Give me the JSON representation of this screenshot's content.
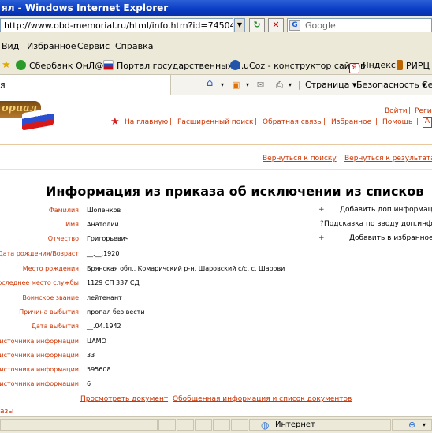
{
  "window": {
    "title": "ял - Windows Internet Explorer"
  },
  "address": {
    "url": "http://www.obd-memorial.ru/html/info.htm?id=74504404",
    "refresh_icon": "refresh-arrows",
    "stop_icon": "stop-x"
  },
  "search": {
    "placeholder": "Google",
    "icon": "google-icon"
  },
  "menu": {
    "items": [
      "Вид",
      "Избранное",
      "Сервис",
      "Справка"
    ]
  },
  "favorites": {
    "items": [
      {
        "label": "Сбербанк ОнЛ@йн",
        "icon": "sberbank-icon",
        "color": "#2a9a2a"
      },
      {
        "label": "Портал государственных ...",
        "icon": "russia-flag-icon",
        "color": "#cc0000"
      },
      {
        "label": "uCoz - конструктор сайтов",
        "icon": "ucoz-icon",
        "color": "#2255aa"
      },
      {
        "label": "Яндекс",
        "icon": "yandex-icon",
        "color": "#cc0000"
      },
      {
        "label": "РИРЦ Р",
        "icon": "pen-icon",
        "color": "#bb6600"
      }
    ]
  },
  "commandbar": {
    "tab_label": "я",
    "items": [
      "Страница",
      "Безопасность",
      "Се"
    ]
  },
  "site": {
    "logo_text": "ориал",
    "top_links": [
      "Войти",
      "Реги"
    ],
    "nav": [
      "На главную",
      "Расширенный поиск",
      "Обратная связь",
      "Избранное",
      "Помощь"
    ],
    "nav_extra": "А",
    "back_search": "Вернуться к поиску",
    "back_results": "Вернуться к результатам"
  },
  "record": {
    "heading": "Информация из приказа об исключении из списков",
    "rows": [
      {
        "label": "Фамилия",
        "value": "Шопенков"
      },
      {
        "label": "Имя",
        "value": "Анатолий"
      },
      {
        "label": "Отчество",
        "value": "Григорьевич"
      },
      {
        "label": "Дата рождения/Возраст",
        "value": "__.__.1920"
      },
      {
        "label": "Место рождения",
        "value": "Брянская обл., Комаричский р-н, Шаровский с/с, с. Шарови"
      },
      {
        "label": "Последнее место службы",
        "value": "1129 СП 337 СД"
      },
      {
        "label": "Воинское звание",
        "value": "лейтенант"
      },
      {
        "label": "Причина выбытия",
        "value": "пропал без вести"
      },
      {
        "label": "Дата выбытия",
        "value": "__.04.1942"
      },
      {
        "label": "е источника информации",
        "value": "ЦАМО"
      },
      {
        "label": "а источника информации",
        "value": "33"
      },
      {
        "label": "к источника информации",
        "value": "595608"
      },
      {
        "label": "а источника информации",
        "value": "6"
      }
    ],
    "actions": [
      {
        "marker": "+",
        "label": "Добавить доп.информаци"
      },
      {
        "marker": "?",
        "label": "Подсказка по вводу доп.инфор"
      },
      {
        "marker": "+",
        "label": "Добавить в избранное"
      }
    ],
    "view_doc": "Просмотреть документ",
    "summary_link": "Обобщенная информация и список документов",
    "footer_fragment": "азы"
  },
  "status": {
    "zone": "Интернет"
  }
}
